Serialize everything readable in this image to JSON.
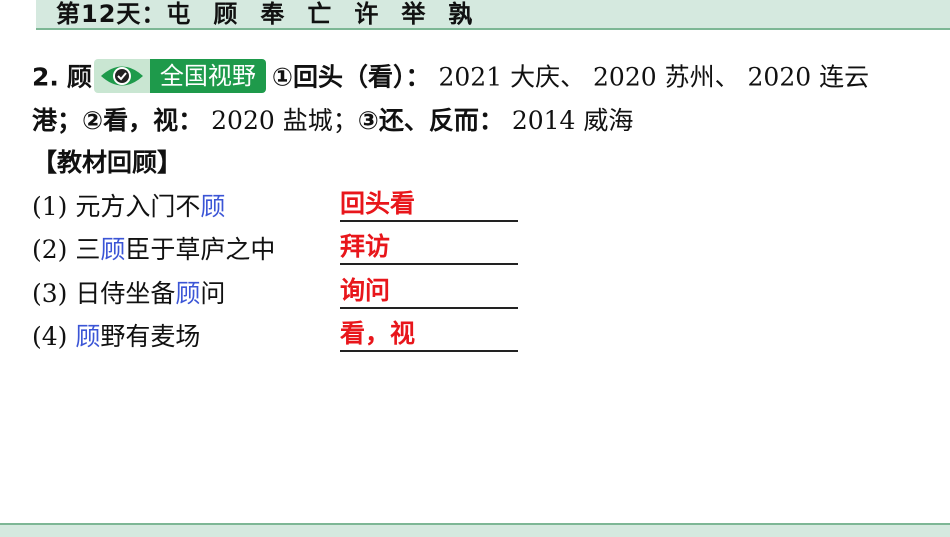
{
  "header": {
    "day_label": "第12天：",
    "chars": [
      "屯",
      "顾",
      "奉",
      "亡",
      "许",
      "举",
      "孰"
    ]
  },
  "entry": {
    "number": "2.",
    "char": "顾",
    "badge": {
      "icon": "eye-icon",
      "label": "全国视野"
    },
    "line1_rest_bold": "①回头（看）：",
    "line1_rest_plain": " 2021 大庆、 2020 苏州、 2020 连云",
    "line2_a_plain_start": "港；",
    "line2_bold_1": "②看，视：",
    "line2_plain_1": " 2020 盐城；",
    "line2_bold_2": "③还、反而：",
    "line2_plain_2": " 2014 威海"
  },
  "review": {
    "heading": "【教材回顾】",
    "items": [
      {
        "num": "(1) ",
        "before": "元方入门不",
        "highlight": "顾",
        "after": "",
        "answer": "回头看"
      },
      {
        "num": "(2) ",
        "before": "三",
        "highlight": "顾",
        "after": "臣于草庐之中",
        "answer": "拜访"
      },
      {
        "num": "(3) ",
        "before": "日侍坐备",
        "highlight": "顾",
        "after": "问",
        "answer": "询问"
      },
      {
        "num": "(4) ",
        "before": "",
        "highlight": "顾",
        "after": "野有麦场",
        "answer": "看，视"
      }
    ]
  },
  "colors": {
    "band_fill": "#d5e9df",
    "band_line": "#7db795",
    "badge_green": "#1e9a4b",
    "highlight_blue": "#3b55d6",
    "answer_red": "#e8161b"
  }
}
